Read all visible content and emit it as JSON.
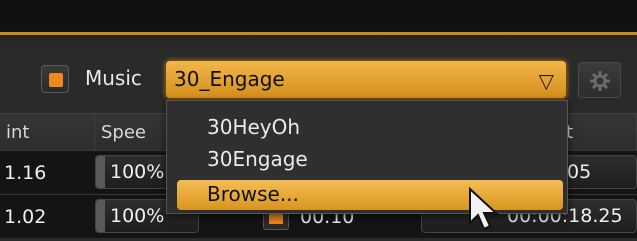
{
  "settings": {
    "music_label": "Music",
    "music_selected": "30_Engage",
    "music_enabled": true,
    "dropdown_arrow_icon": "triangle-down-icon",
    "gear_icon": "gear-icon"
  },
  "dropdown": {
    "options": [
      "30HeyOh",
      "30Engage",
      "Browse..."
    ],
    "highlighted_index": 2
  },
  "table": {
    "headers": [
      "int",
      "Spee",
      "t"
    ],
    "rows": [
      {
        "point": "1.16",
        "speed": "100%",
        "end": "05"
      },
      {
        "point": "1.02",
        "speed": "100%",
        "mark": "00.10",
        "end": "00:00:18.25"
      }
    ]
  },
  "colors": {
    "accent": "#f0a52a",
    "checkbox_fill": "#f08a1f",
    "background": "#2b2b2b"
  }
}
